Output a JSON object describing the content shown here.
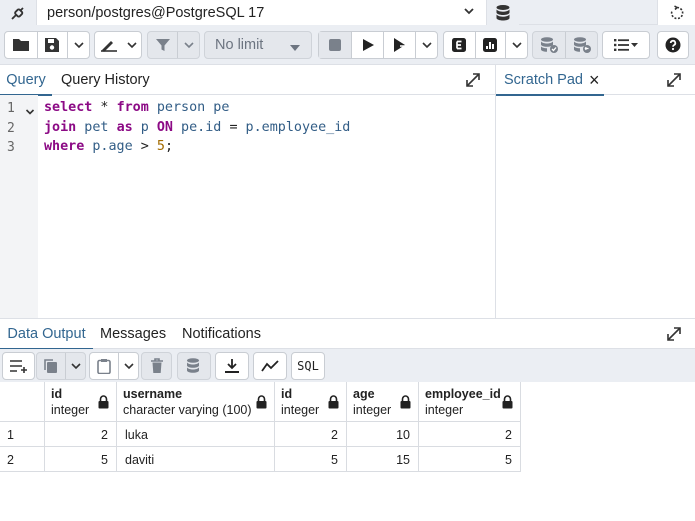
{
  "connection": {
    "label": "person/postgres@PostgreSQL 17",
    "icons": [
      "plug-icon",
      "chevron-down-icon",
      "database-icon",
      "refresh-icon"
    ]
  },
  "toolbar": {
    "limit_label": "No limit",
    "icons": [
      "folder-icon",
      "save-icon",
      "edit-pen-icon",
      "filter-icon",
      "stop-icon",
      "execute-icon",
      "execute-script-icon",
      "explain-icon",
      "explain-analyze-icon",
      "commit-icon",
      "rollback-icon",
      "macros-icon",
      "help-icon"
    ]
  },
  "editor_tabs": {
    "query": "Query",
    "history": "Query History"
  },
  "scratch_pad": {
    "title": "Scratch Pad",
    "close": "×"
  },
  "editor": {
    "line_numbers": [
      "1",
      "2",
      "3"
    ],
    "lines": [
      [
        {
          "t": "select",
          "c": "kw"
        },
        {
          "t": " * ",
          "c": "op"
        },
        {
          "t": "from",
          "c": "kw"
        },
        {
          "t": " person pe",
          "c": "id"
        }
      ],
      [
        {
          "t": "join",
          "c": "kw"
        },
        {
          "t": " pet ",
          "c": "id"
        },
        {
          "t": "as",
          "c": "kw"
        },
        {
          "t": " p ",
          "c": "id"
        },
        {
          "t": "ON",
          "c": "kw"
        },
        {
          "t": " pe.id ",
          "c": "id"
        },
        {
          "t": "=",
          "c": "op"
        },
        {
          "t": " p.employee_id",
          "c": "id"
        }
      ],
      [
        {
          "t": "where",
          "c": "kw"
        },
        {
          "t": " p.age ",
          "c": "id"
        },
        {
          "t": ">",
          "c": "op"
        },
        {
          "t": " ",
          "c": "op"
        },
        {
          "t": "5",
          "c": "num"
        },
        {
          "t": ";",
          "c": "op"
        }
      ]
    ]
  },
  "output_tabs": {
    "data_output": "Data Output",
    "messages": "Messages",
    "notifications": "Notifications"
  },
  "output_toolbar": {
    "sql_label": "SQL",
    "icons": [
      "add-row-icon",
      "copy-icon",
      "paste-icon",
      "delete-icon",
      "save-data-icon",
      "download-icon",
      "graph-icon"
    ]
  },
  "table": {
    "columns": [
      {
        "name": "id",
        "type": "integer"
      },
      {
        "name": "username",
        "type": "character varying (100)"
      },
      {
        "name": "id",
        "type": "integer"
      },
      {
        "name": "age",
        "type": "integer"
      },
      {
        "name": "employee_id",
        "type": "integer"
      }
    ],
    "rows": [
      {
        "num": "1",
        "cells": [
          "2",
          "luka",
          "2",
          "10",
          "2"
        ]
      },
      {
        "num": "2",
        "cells": [
          "5",
          "daviti",
          "5",
          "15",
          "5"
        ]
      }
    ]
  },
  "colors": {
    "accent": "#326690",
    "keyword": "#8c0a85",
    "identifier": "#325d86",
    "number": "#a36b00",
    "toolbar_bg": "#ebeef3"
  }
}
